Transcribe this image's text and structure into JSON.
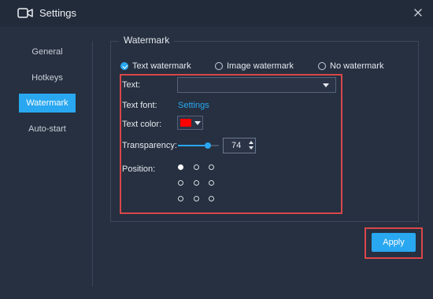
{
  "window": {
    "title": "Settings",
    "app_icon": "video-camera-icon",
    "close_icon": "close-icon"
  },
  "sidebar": {
    "items": [
      {
        "label": "General",
        "active": false
      },
      {
        "label": "Hotkeys",
        "active": false
      },
      {
        "label": "Watermark",
        "active": true
      },
      {
        "label": "Auto-start",
        "active": false
      }
    ]
  },
  "watermark": {
    "group_title": "Watermark",
    "modes": [
      {
        "label": "Text watermark",
        "checked": true
      },
      {
        "label": "Image watermark",
        "checked": false
      },
      {
        "label": "No watermark",
        "checked": false
      }
    ],
    "text_label": "Text:",
    "text_value": "",
    "font_label": "Text font:",
    "font_link": "Settings",
    "color_label": "Text color:",
    "text_color": "#ff0000",
    "transparency_label": "Transparency:",
    "transparency_value": "74",
    "transparency_slider_fraction": 0.74,
    "position_label": "Position:",
    "position_selected": "top-left"
  },
  "footer": {
    "apply_label": "Apply"
  },
  "colors": {
    "accent": "#29a7f0",
    "highlight_border": "#d9474a",
    "background": "#263040",
    "titlebar": "#222b3a"
  }
}
